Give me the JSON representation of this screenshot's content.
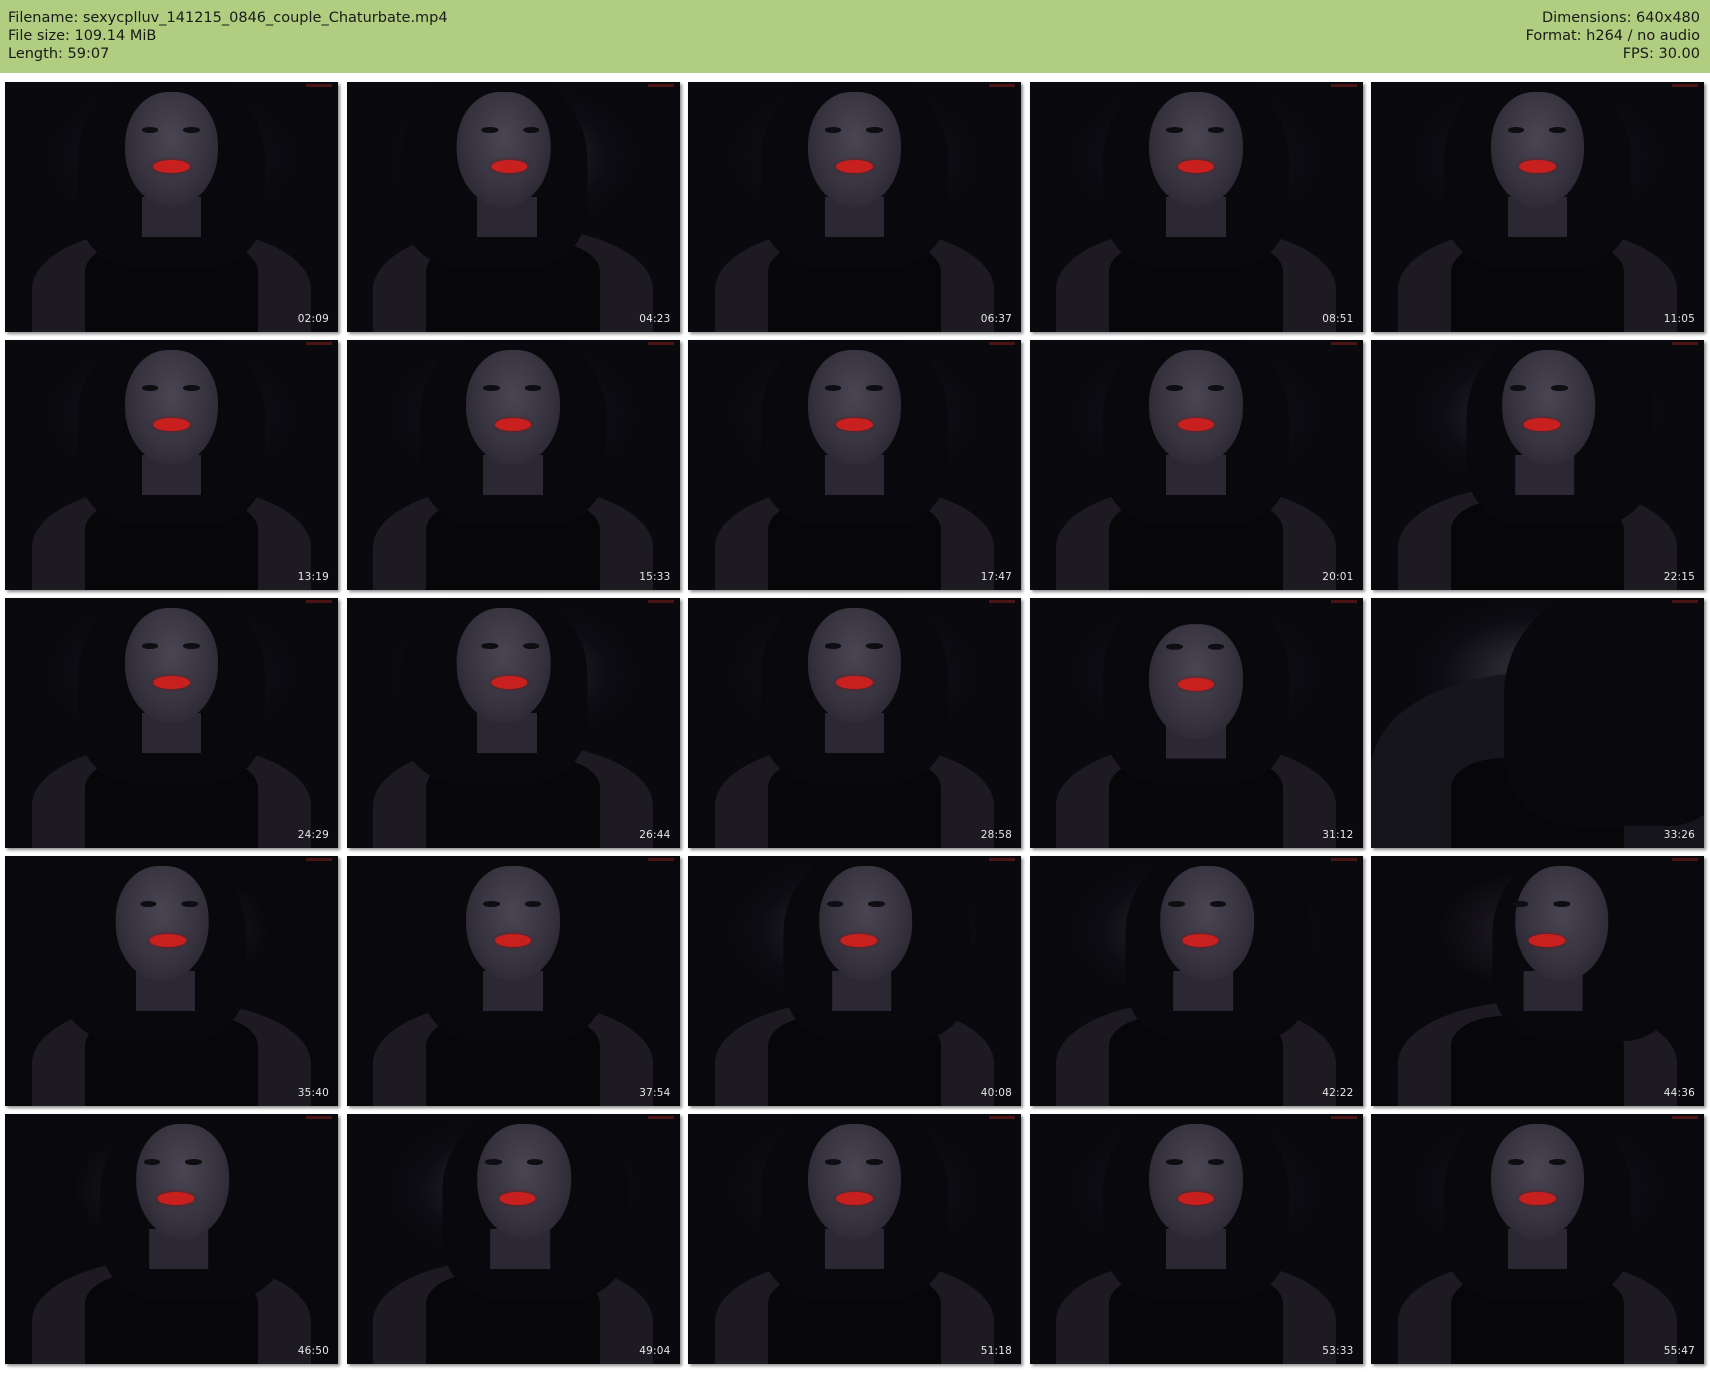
{
  "info": {
    "filename_line": "Filename: sexycplluv_141215_0846_couple_Chaturbate.mp4",
    "filesize_line": "File size: 109.14 MiB",
    "length_line": "Length: 59:07",
    "dimensions_line": "Dimensions: 640x480",
    "format_line": "Format: h264 / no audio",
    "fps_line": "FPS: 30.00"
  },
  "colors": {
    "header_background": "#b1cd7f",
    "lipstick": "#c8201e"
  },
  "thumbnails": [
    {
      "timestamp": "02:09"
    },
    {
      "timestamp": "04:23"
    },
    {
      "timestamp": "06:37"
    },
    {
      "timestamp": "08:51"
    },
    {
      "timestamp": "11:05"
    },
    {
      "timestamp": "13:19"
    },
    {
      "timestamp": "15:33"
    },
    {
      "timestamp": "17:47"
    },
    {
      "timestamp": "20:01"
    },
    {
      "timestamp": "22:15"
    },
    {
      "timestamp": "24:29"
    },
    {
      "timestamp": "26:44"
    },
    {
      "timestamp": "28:58"
    },
    {
      "timestamp": "31:12"
    },
    {
      "timestamp": "33:26"
    },
    {
      "timestamp": "35:40"
    },
    {
      "timestamp": "37:54"
    },
    {
      "timestamp": "40:08"
    },
    {
      "timestamp": "42:22"
    },
    {
      "timestamp": "44:36"
    },
    {
      "timestamp": "46:50"
    },
    {
      "timestamp": "49:04"
    },
    {
      "timestamp": "51:18"
    },
    {
      "timestamp": "53:33"
    },
    {
      "timestamp": "55:47"
    }
  ]
}
